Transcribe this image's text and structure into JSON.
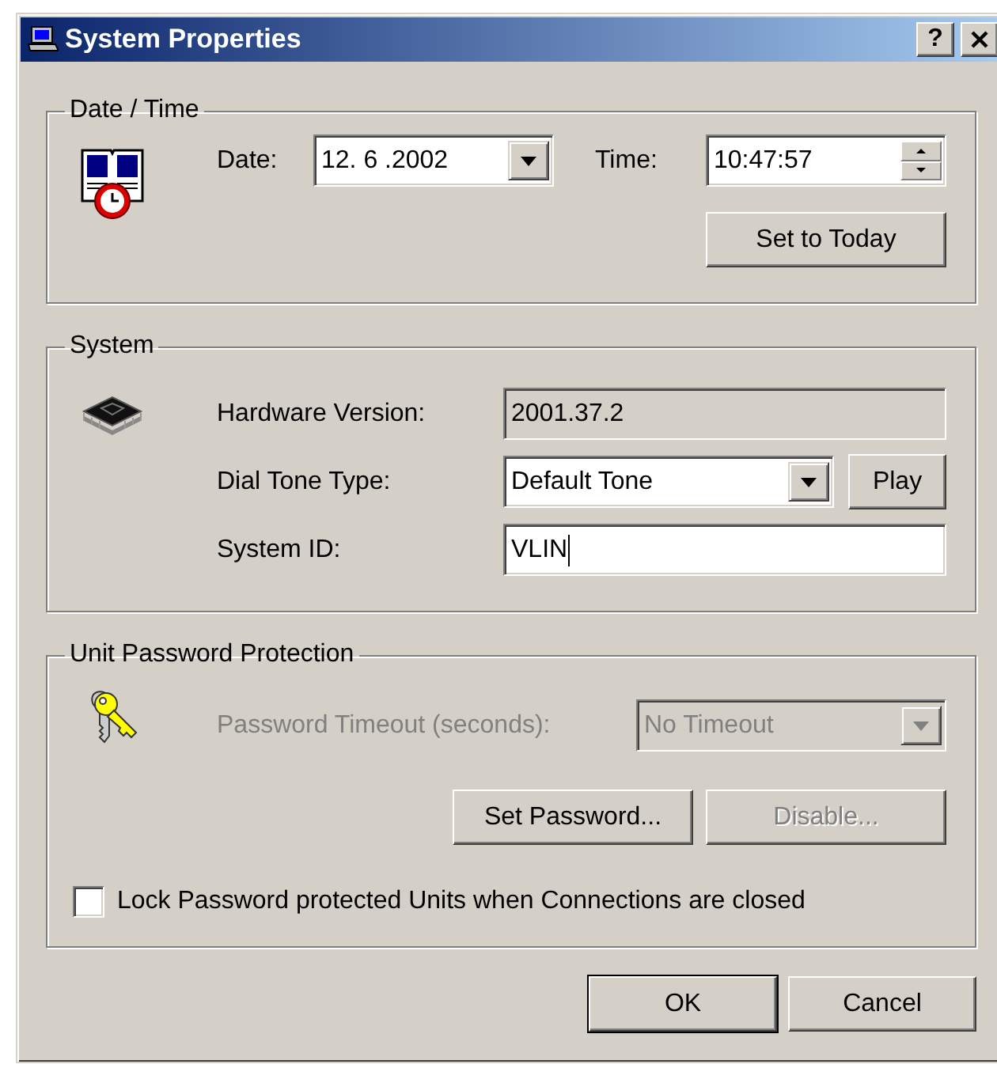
{
  "window": {
    "title": "System Properties",
    "help_button": "?"
  },
  "date_time": {
    "title": "Date / Time",
    "date": {
      "label": "Date:",
      "value": "12. 6 .2002"
    },
    "time": {
      "label": "Time:",
      "value": "10:47:57"
    },
    "set_today_button": "Set to Today"
  },
  "system": {
    "title": "System",
    "hardware_version": {
      "label": "Hardware Version:",
      "value": "2001.37.2",
      "read_only": true
    },
    "dial_tone": {
      "label": "Dial Tone Type:",
      "value": "Default Tone"
    },
    "play_button": "Play",
    "system_id": {
      "label": "System ID:",
      "value": "VLIN",
      "focused": true
    }
  },
  "password": {
    "title": "Unit Password Protection",
    "timeout": {
      "label": "Password Timeout (seconds):",
      "value": "No Timeout",
      "disabled": true
    },
    "buttons": [
      {
        "label": "Set Password...",
        "disabled": false
      },
      {
        "label": "Disable...",
        "disabled": true
      }
    ],
    "lock_units": {
      "label": "Lock Password protected Units when Connections are closed",
      "checked": false
    }
  },
  "buttons": [
    {
      "label": "OK",
      "default": true
    },
    {
      "label": "Cancel",
      "default": false
    }
  ]
}
